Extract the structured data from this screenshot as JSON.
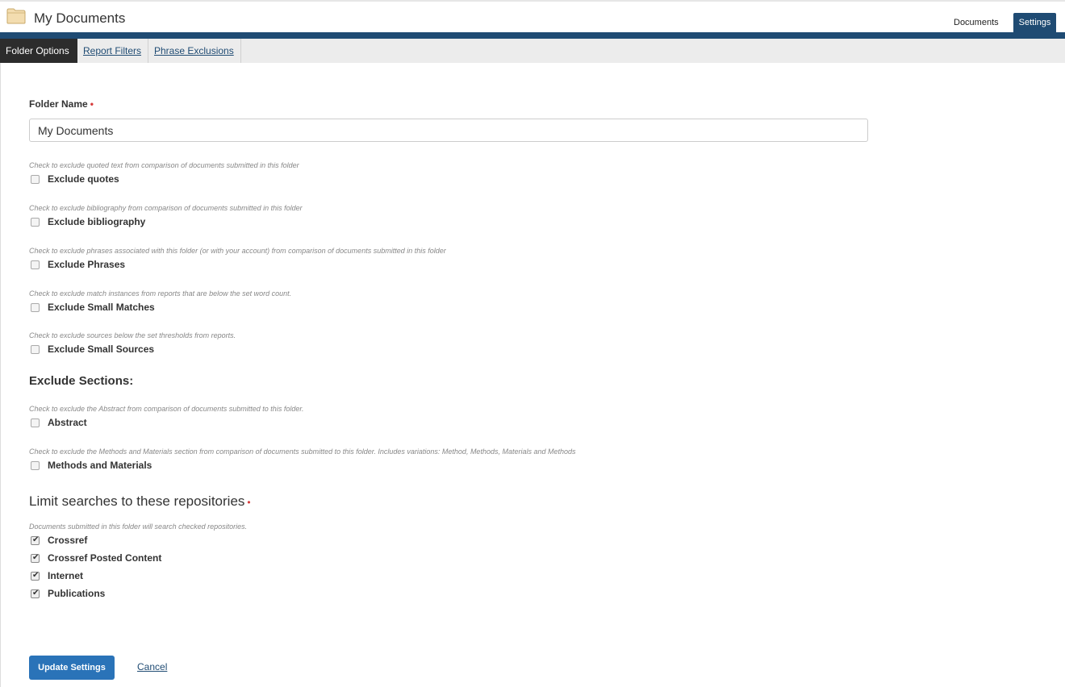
{
  "header": {
    "title": "My Documents",
    "folder_icon": "folder-icon",
    "tabs": [
      "Documents",
      "Settings"
    ]
  },
  "subtabs": [
    "Folder Options",
    "Report Filters",
    "Phrase Exclusions"
  ],
  "form": {
    "folder_name_label": "Folder Name",
    "required_mark": "•",
    "folder_name_value": "My Documents",
    "options": [
      {
        "hint": "Check to exclude quoted text from comparison of documents submitted in this folder",
        "label": "Exclude quotes",
        "checked": false
      },
      {
        "hint": "Check to exclude bibliography from comparison of documents submitted in this folder",
        "label": "Exclude bibliography",
        "checked": false
      },
      {
        "hint": "Check to exclude phrases associated with this folder (or with your account) from comparison of documents submitted in this folder",
        "label": "Exclude Phrases",
        "checked": false
      },
      {
        "hint": "Check to exclude match instances from reports that are below the set word count.",
        "label": "Exclude Small Matches",
        "checked": false
      },
      {
        "hint": "Check to exclude sources below the set thresholds from reports.",
        "label": "Exclude Small Sources",
        "checked": false
      }
    ],
    "exclude_sections_heading": "Exclude Sections:",
    "sections": [
      {
        "hint": "Check to exclude the Abstract from comparison of documents submitted to this folder.",
        "label": "Abstract",
        "checked": false
      },
      {
        "hint": "Check to exclude the Methods and Materials section from comparison of documents submitted to this folder. Includes variations: Method, Methods, Materials and Methods",
        "label": "Methods and Materials",
        "checked": false
      }
    ],
    "repositories_heading": "Limit searches to these repositories",
    "repositories_hint": "Documents submitted in this folder will search checked repositories.",
    "repositories": [
      {
        "label": "Crossref",
        "checked": true
      },
      {
        "label": "Crossref Posted Content",
        "checked": true
      },
      {
        "label": "Internet",
        "checked": true
      },
      {
        "label": "Publications",
        "checked": true
      }
    ],
    "update_button": "Update Settings",
    "cancel_link": "Cancel",
    "check_glyph": "✔"
  }
}
